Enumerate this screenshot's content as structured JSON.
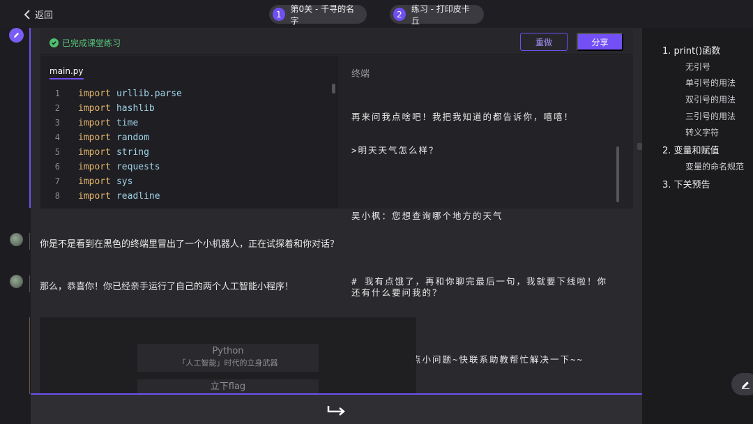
{
  "nav": {
    "back_label": "返回",
    "steps": [
      {
        "num": "1",
        "label": "第0关 - 千寻的名字"
      },
      {
        "num": "2",
        "label": "练习 - 打印皮卡丘"
      }
    ]
  },
  "exercise": {
    "status": "已完成课堂练习",
    "redo_label": "重做",
    "share_label": "分享",
    "file_tab": "main.py",
    "code": [
      {
        "n": "1",
        "kw": "import",
        "mod": "urllib.parse"
      },
      {
        "n": "2",
        "kw": "import",
        "mod": "hashlib"
      },
      {
        "n": "3",
        "kw": "import",
        "mod": "time"
      },
      {
        "n": "4",
        "kw": "import",
        "mod": "random"
      },
      {
        "n": "5",
        "kw": "import",
        "mod": "string"
      },
      {
        "n": "6",
        "kw": "import",
        "mod": "requests"
      },
      {
        "n": "7",
        "kw": "import",
        "mod": "sys"
      },
      {
        "n": "8",
        "kw": "import",
        "mod": "readline"
      }
    ],
    "terminal_title": "终端",
    "terminal_lines": [
      "再来问我点啥吧！我把我知道的都告诉你，嘻嘻！",
      ">明天天气怎么样？",
      "",
      "吴小枫：您想查询哪个地方的天气",
      "",
      "# 我有点饿了，再和你聊完最后一句，我就要下线啦！你还有什么要问我的？",
      "# >",
      "今天我出了一点小问题~快联系助教帮忙解决一下~~"
    ]
  },
  "messages": [
    "你是不是看到在黑色的终端里冒出了一个小机器人，正在试探着和你对话？",
    "那么，恭喜你！你已经亲手运行了自己的两个人工智能小程序！"
  ],
  "course_card": {
    "title": "Python",
    "subtitle": "「人工智能」时代的立身武器",
    "flag": "立下flag"
  },
  "toc": {
    "items": [
      {
        "label": "1. print()函数",
        "subs": [
          "无引号",
          "单引号的用法",
          "双引号的用法",
          "三引号的用法",
          "转义字符"
        ]
      },
      {
        "label": "2. 变量和赋值",
        "subs": [
          "变量的命名规范"
        ]
      },
      {
        "label": "3. 下关预告",
        "subs": []
      }
    ]
  }
}
